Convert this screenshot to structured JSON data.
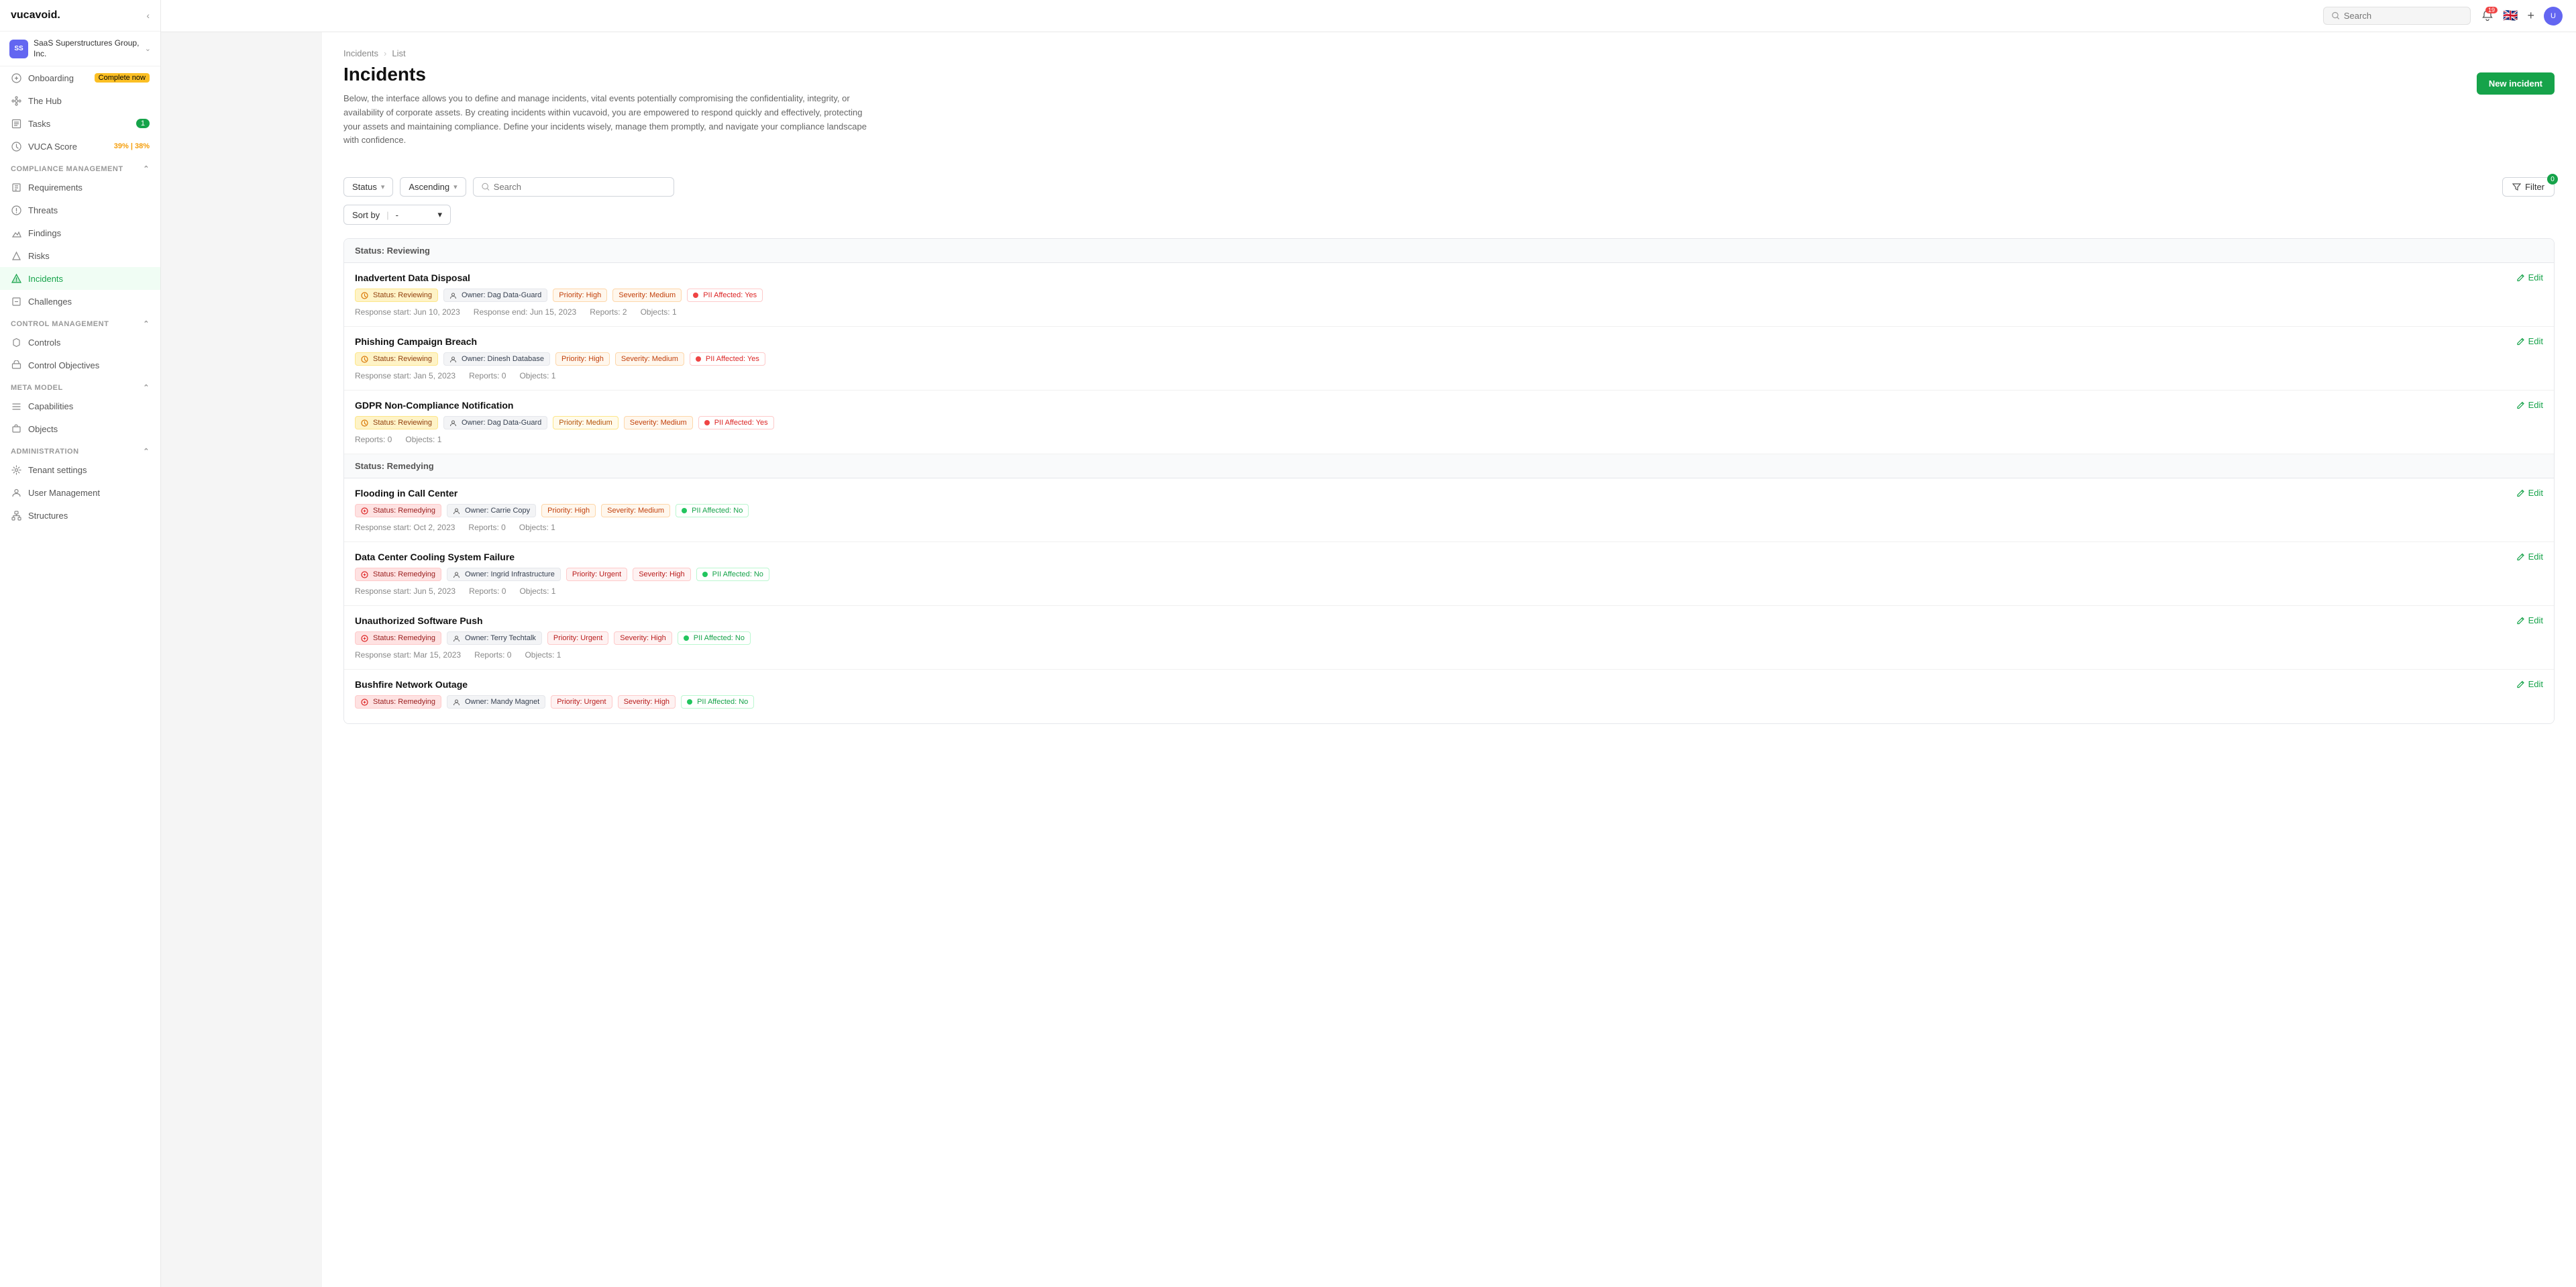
{
  "app": {
    "logo": "vucavoid.",
    "logo_dot_char": "."
  },
  "topbar": {
    "search_placeholder": "Search",
    "notification_count": "19",
    "plus_label": "+",
    "flag_emoji": "🇬🇧"
  },
  "org": {
    "name": "SaaS Superstructures Group, Inc.",
    "initials": "SS"
  },
  "sidebar": {
    "onboarding_label": "Onboarding",
    "onboarding_badge": "Complete now",
    "the_hub_label": "The Hub",
    "tasks_label": "Tasks",
    "tasks_badge": "1",
    "vuca_score_label": "VUCA Score",
    "vuca_score_value": "39% | 38%",
    "compliance_section": "Compliance Management",
    "requirements_label": "Requirements",
    "threats_label": "Threats",
    "findings_label": "Findings",
    "risks_label": "Risks",
    "incidents_label": "Incidents",
    "challenges_label": "Challenges",
    "control_section": "Control Management",
    "controls_label": "Controls",
    "control_objectives_label": "Control Objectives",
    "meta_section": "Meta Model",
    "capabilities_label": "Capabilities",
    "objects_label": "Objects",
    "admin_section": "Administration",
    "tenant_settings_label": "Tenant settings",
    "user_management_label": "User Management",
    "structures_label": "Structures"
  },
  "page": {
    "breadcrumb_incidents": "Incidents",
    "breadcrumb_list": "List",
    "title": "Incidents",
    "description": "Below, the interface allows you to define and manage incidents, vital events potentially compromising the confidentiality, integrity, or availability of corporate assets. By creating incidents within vucavoid, you are empowered to respond quickly and effectively, protecting your assets and maintaining compliance. Define your incidents wisely, manage them promptly, and navigate your compliance landscape with confidence.",
    "new_incident_btn": "New incident"
  },
  "filters": {
    "status_label": "Status",
    "ascending_label": "Ascending",
    "search_placeholder": "Search",
    "filter_label": "Filter",
    "filter_count": "0",
    "sort_by_label": "Sort by",
    "sort_by_value": "-"
  },
  "status_groups": [
    {
      "status": "Status: Reviewing",
      "incidents": [
        {
          "name": "Inadvertent Data Disposal",
          "status_tag": "Status: Reviewing",
          "status_type": "reviewing",
          "owner": "Owner: Dag Data-Guard",
          "priority": "Priority: High",
          "priority_type": "high",
          "severity": "Severity: Medium",
          "severity_type": "medium",
          "pii": "PII Affected: Yes",
          "pii_type": "yes",
          "response_start": "Response start: Jun 10, 2023",
          "response_end": "Response end: Jun 15, 2023",
          "reports": "Reports: 2",
          "objects": "Objects: 1"
        },
        {
          "name": "Phishing Campaign Breach",
          "status_tag": "Status: Reviewing",
          "status_type": "reviewing",
          "owner": "Owner: Dinesh Database",
          "priority": "Priority: High",
          "priority_type": "high",
          "severity": "Severity: Medium",
          "severity_type": "medium",
          "pii": "PII Affected: Yes",
          "pii_type": "yes",
          "response_start": "Response start: Jan 5, 2023",
          "response_end": null,
          "reports": "Reports: 0",
          "objects": "Objects: 1"
        },
        {
          "name": "GDPR Non-Compliance Notification",
          "status_tag": "Status: Reviewing",
          "status_type": "reviewing",
          "owner": "Owner: Dag Data-Guard",
          "priority": "Priority: Medium",
          "priority_type": "medium",
          "severity": "Severity: Medium",
          "severity_type": "medium",
          "pii": "PII Affected: Yes",
          "pii_type": "yes",
          "response_start": null,
          "response_end": null,
          "reports": "Reports: 0",
          "objects": "Objects: 1"
        }
      ]
    },
    {
      "status": "Status: Remedying",
      "incidents": [
        {
          "name": "Flooding in Call Center",
          "status_tag": "Status: Remedying",
          "status_type": "remedying",
          "owner": "Owner: Carrie Copy",
          "priority": "Priority: High",
          "priority_type": "high",
          "severity": "Severity: Medium",
          "severity_type": "medium",
          "pii": "PII Affected: No",
          "pii_type": "no",
          "response_start": "Response start: Oct 2, 2023",
          "response_end": null,
          "reports": "Reports: 0",
          "objects": "Objects: 1"
        },
        {
          "name": "Data Center Cooling System Failure",
          "status_tag": "Status: Remedying",
          "status_type": "remedying",
          "owner": "Owner: Ingrid Infrastructure",
          "priority": "Priority: Urgent",
          "priority_type": "urgent",
          "severity": "Severity: High",
          "severity_type": "high",
          "pii": "PII Affected: No",
          "pii_type": "no",
          "response_start": "Response start: Jun 5, 2023",
          "response_end": null,
          "reports": "Reports: 0",
          "objects": "Objects: 1"
        },
        {
          "name": "Unauthorized Software Push",
          "status_tag": "Status: Remedying",
          "status_type": "remedying",
          "owner": "Owner: Terry Techtalk",
          "priority": "Priority: Urgent",
          "priority_type": "urgent",
          "severity": "Severity: High",
          "severity_type": "high",
          "pii": "PII Affected: No",
          "pii_type": "no",
          "response_start": "Response start: Mar 15, 2023",
          "response_end": null,
          "reports": "Reports: 0",
          "objects": "Objects: 1"
        },
        {
          "name": "Bushfire Network Outage",
          "status_tag": "Status: Remedying",
          "status_type": "remedying",
          "owner": "Owner: Mandy Magnet",
          "priority": "Priority: Urgent",
          "priority_type": "urgent",
          "severity": "Severity: High",
          "severity_type": "high",
          "pii": "PII Affected: No",
          "pii_type": "no",
          "response_start": null,
          "response_end": null,
          "reports": null,
          "objects": null
        }
      ]
    }
  ],
  "edit_label": "Edit"
}
